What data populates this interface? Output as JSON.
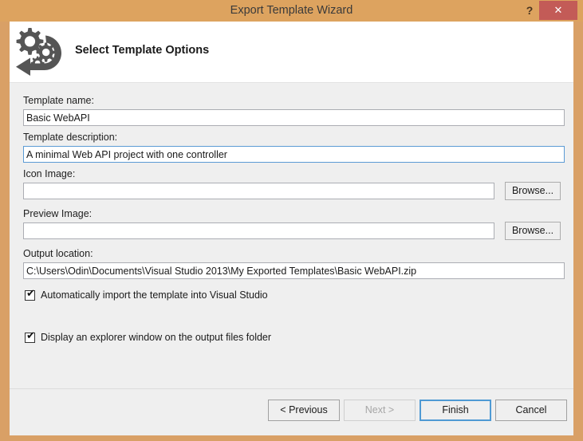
{
  "window": {
    "title": "Export Template Wizard",
    "help_label": "?",
    "close_label": "✕",
    "frame_color": "#dda35f",
    "close_color": "#c35b57"
  },
  "header": {
    "icon_name": "export-template-gears-icon",
    "heading": "Select Template Options"
  },
  "form": {
    "template_name": {
      "label": "Template name:",
      "value": "Basic WebAPI",
      "placeholder": ""
    },
    "template_description": {
      "label": "Template description:",
      "value": "A minimal Web API project with one controller",
      "placeholder": "",
      "focused": true
    },
    "icon_image": {
      "label": "Icon Image:",
      "value": "",
      "placeholder": "",
      "browse_label": "Browse..."
    },
    "preview_image": {
      "label": "Preview Image:",
      "value": "",
      "placeholder": "",
      "browse_label": "Browse..."
    },
    "output_location": {
      "label": "Output location:",
      "value": "C:\\Users\\Odin\\Documents\\Visual Studio 2013\\My Exported Templates\\Basic WebAPI.zip",
      "placeholder": ""
    },
    "checkboxes": [
      {
        "label": "Automatically import the template into Visual Studio",
        "checked": true,
        "tick": "✔"
      },
      {
        "label": "Display an explorer window on the output files folder",
        "checked": true,
        "tick": "✔"
      }
    ]
  },
  "footer": {
    "previous_label": "< Previous",
    "next_label": "Next >",
    "finish_label": "Finish",
    "cancel_label": "Cancel"
  }
}
